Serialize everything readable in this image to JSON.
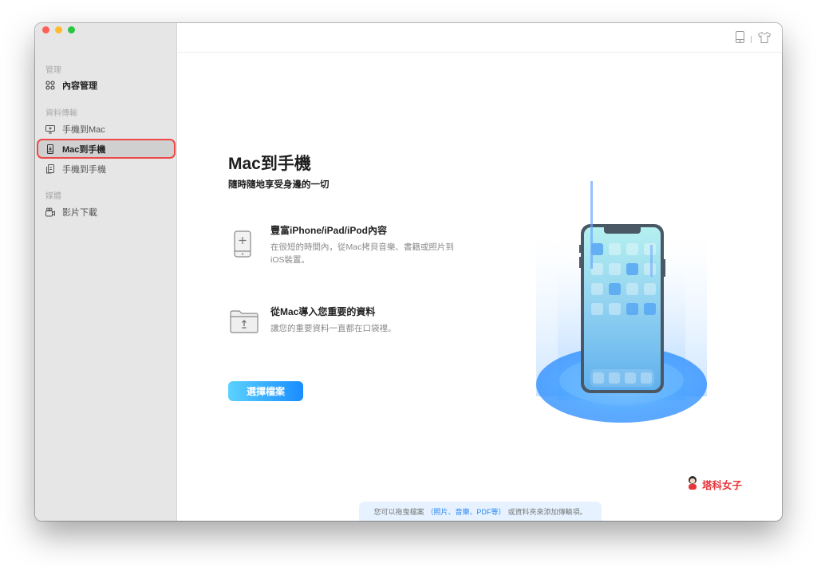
{
  "sidebar": {
    "sections": [
      {
        "label": "管理",
        "items": [
          {
            "label": "內容管理",
            "icon": "grid-icon",
            "active": false
          }
        ]
      },
      {
        "label": "資料傳輸",
        "items": [
          {
            "label": "手機到Mac",
            "icon": "monitor-icon",
            "active": false
          },
          {
            "label": "Mac到手機",
            "icon": "phone-import-icon",
            "active": true
          },
          {
            "label": "手機到手機",
            "icon": "phone-to-phone-icon",
            "active": false
          }
        ]
      },
      {
        "label": "媒體",
        "items": [
          {
            "label": "影片下載",
            "icon": "video-download-icon",
            "active": false
          }
        ]
      }
    ]
  },
  "toolbar": {
    "icons": [
      "device-icon",
      "tshirt-icon"
    ]
  },
  "main": {
    "title": "Mac到手機",
    "subtitle": "隨時隨地享受身邊的一切",
    "features": [
      {
        "icon": "phone-plus-icon",
        "title": "豐富iPhone/iPad/iPod內容",
        "desc": "在很短的時間內，從Mac拷貝音樂、書籍或照片到iOS裝置。"
      },
      {
        "icon": "folder-upload-icon",
        "title": "從Mac導入您重要的資料",
        "desc": "讓您的重要資料一直都在口袋裡。"
      }
    ],
    "button_label": "選擇檔案"
  },
  "hint": {
    "prefix": "您可以拖曳檔案",
    "link": "（照片、音樂、PDF等）",
    "suffix": "或資料夾來添加傳輸項。"
  },
  "watermark": {
    "text": "塔科女子"
  },
  "colors": {
    "accent": "#1a8cff",
    "accent_light": "#5bd2ff",
    "highlight": "#f04848",
    "sidebar_bg": "#e6e6e6"
  }
}
